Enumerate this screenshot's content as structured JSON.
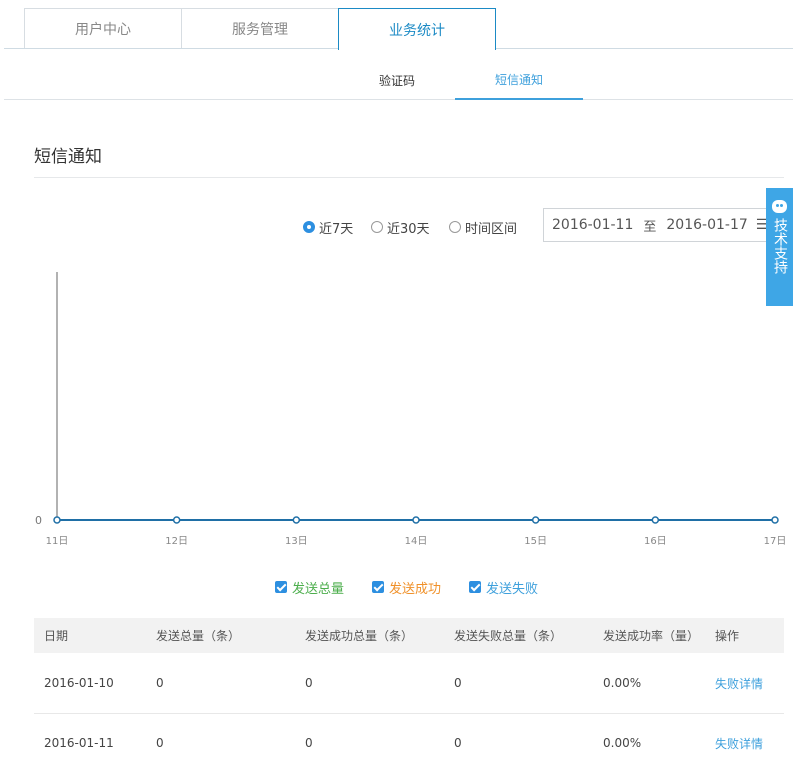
{
  "top_tabs": [
    {
      "label": "用户中心"
    },
    {
      "label": "服务管理"
    },
    {
      "label": "业务统计"
    }
  ],
  "sub_tabs": [
    {
      "label": "验证码"
    },
    {
      "label": "短信通知"
    }
  ],
  "section_title": "短信通知",
  "range": {
    "options": [
      "近7天",
      "近30天",
      "时间区间"
    ],
    "selected": "近7天",
    "start_date": "2016-01-11",
    "separator": "至",
    "end_date": "2016-01-17",
    "calendar_icon": "calendar-icon"
  },
  "support": {
    "label": "技术支持",
    "icon": "robot-face-icon"
  },
  "legend": [
    {
      "label": "发送总量",
      "color": "#4cae4c",
      "checked": true
    },
    {
      "label": "发送成功",
      "color": "#f0912a",
      "checked": true
    },
    {
      "label": "发送失败",
      "color": "#3ea0dc",
      "checked": true
    }
  ],
  "chart_data": {
    "type": "line",
    "categories": [
      "11日",
      "12日",
      "13日",
      "14日",
      "15日",
      "16日",
      "17日"
    ],
    "y_tick_labels": [
      "0"
    ],
    "series": [
      {
        "name": "发送总量",
        "color": "#4cae4c",
        "values": [
          0,
          0,
          0,
          0,
          0,
          0,
          0
        ]
      },
      {
        "name": "发送成功",
        "color": "#f0912a",
        "values": [
          0,
          0,
          0,
          0,
          0,
          0,
          0
        ]
      },
      {
        "name": "发送失败",
        "color": "#1f6fa6",
        "values": [
          0,
          0,
          0,
          0,
          0,
          0,
          0
        ]
      }
    ]
  },
  "table": {
    "headers": [
      "日期",
      "发送总量（条）",
      "发送成功总量（条）",
      "发送失败总量（条）",
      "发送成功率（量）",
      "操作"
    ],
    "rows": [
      [
        "2016-01-10",
        "0",
        "0",
        "0",
        "0.00%",
        "失败详情"
      ],
      [
        "2016-01-11",
        "0",
        "0",
        "0",
        "0.00%",
        "失败详情"
      ]
    ]
  }
}
